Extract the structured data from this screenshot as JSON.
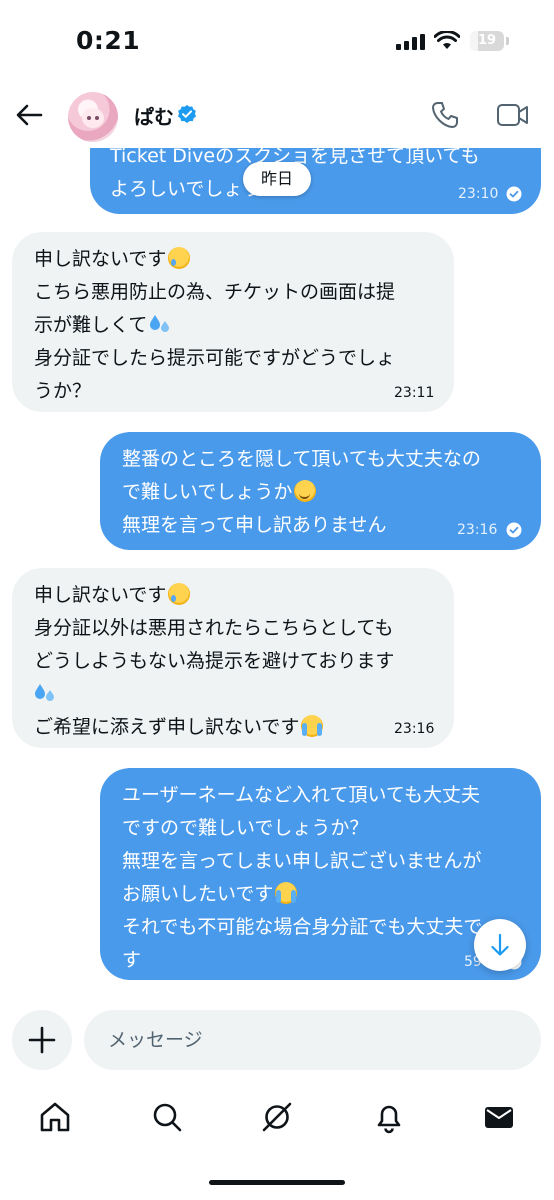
{
  "status_bar": {
    "time": "0:21",
    "battery": "19"
  },
  "header": {
    "contact_name": "ぱむ"
  },
  "date_divider": "昨日",
  "messages": [
    {
      "side": "out",
      "lines": [
        "Ticket Diveのスクショを見させて頂いても",
        "よろしいでしょうか？"
      ],
      "time": "23:10"
    },
    {
      "side": "in",
      "lines": [
        "申し訳ないです",
        "こちら悪用防止の為、チケットの画面は提",
        "示が難しくて",
        "身分証でしたら提示可能ですがどうでしょ",
        "うか？"
      ],
      "time": "23:11"
    },
    {
      "side": "out",
      "lines": [
        "整番のところを隠して頂いても大丈夫なの",
        "で難しいでしょうか",
        "無理を言って申し訳ありません"
      ],
      "time": "23:16"
    },
    {
      "side": "in",
      "lines": [
        "申し訳ないです",
        "身分証以外は悪用されたらこちらとしても",
        "どうしようもない為提示を避けております",
        "",
        "ご希望に添えず申し訳ないです"
      ],
      "time": "23:16"
    },
    {
      "side": "out",
      "lines": [
        "ユーザーネームなど入れて頂いても大丈夫",
        "ですので難しいでしょうか？",
        "無理を言ってしまい申し訳ございませんが",
        "お願いしたいです",
        "それでも不可能な場合身分証でも大丈夫で",
        "す"
      ],
      "time": "59"
    }
  ],
  "composer": {
    "placeholder": "メッセージ"
  },
  "icons": {
    "back": "back-arrow-icon",
    "verified": "verified-badge-icon",
    "phone": "phone-icon",
    "video": "video-icon",
    "add": "plus-icon",
    "scroll_down": "arrow-down-icon",
    "tabs": [
      "home-icon",
      "search-icon",
      "grok-icon",
      "bell-icon",
      "mail-icon"
    ]
  },
  "colors": {
    "outgoing_bubble": "#4a9aeb",
    "incoming_bubble": "#eff3f4",
    "verified": "#1d9bf0"
  }
}
